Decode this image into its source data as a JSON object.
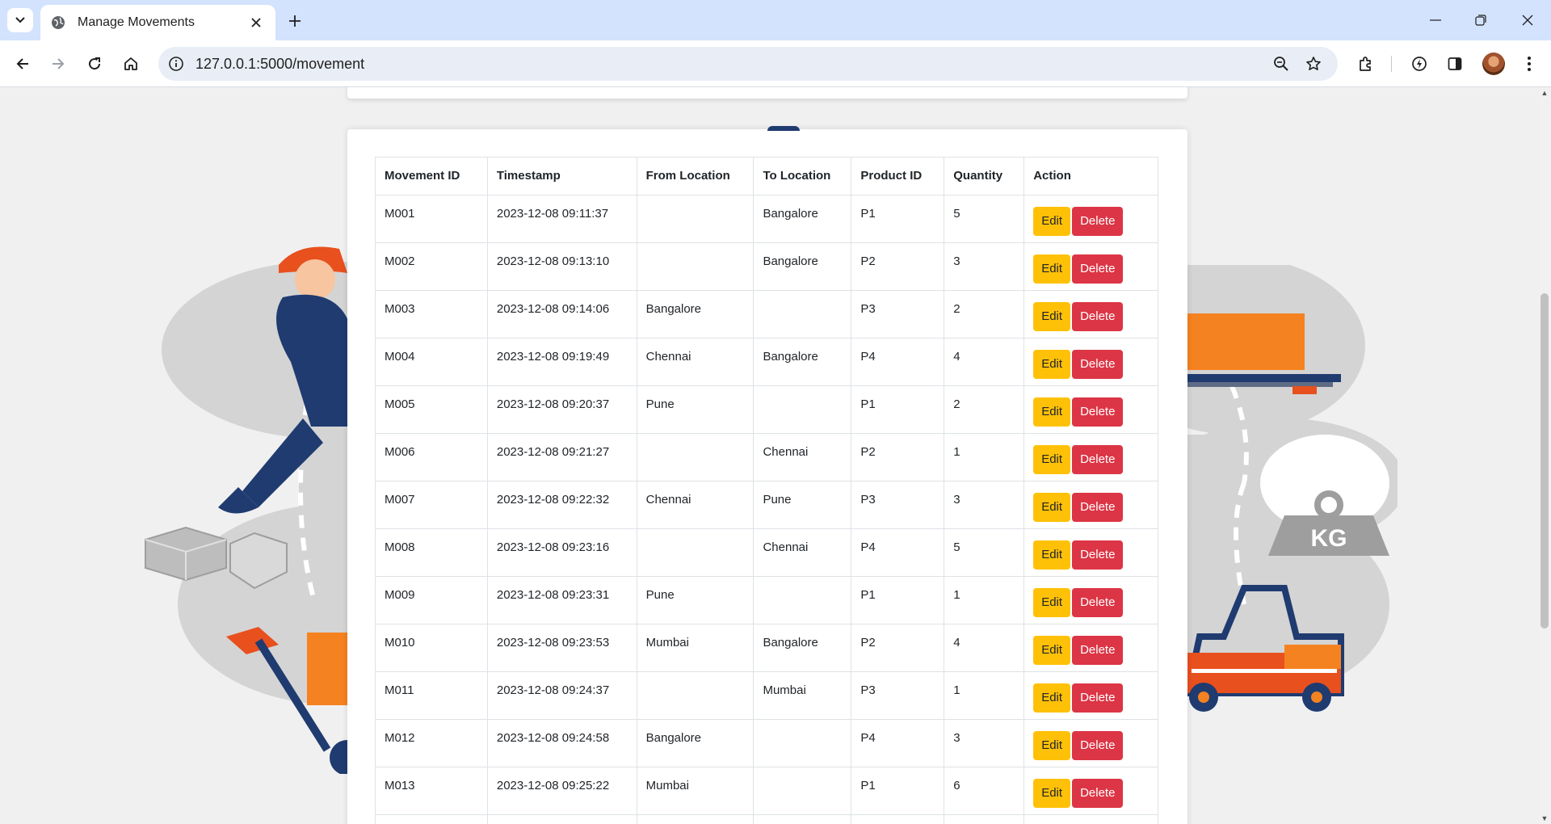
{
  "browser": {
    "tab_title": "Manage Movements",
    "url": "127.0.0.1:5000/movement"
  },
  "table": {
    "headers": [
      "Movement ID",
      "Timestamp",
      "From Location",
      "To Location",
      "Product ID",
      "Quantity",
      "Action"
    ],
    "rows": [
      {
        "id": "M001",
        "ts": "2023-12-08 09:11:37",
        "from": "",
        "to": "Bangalore",
        "product": "P1",
        "qty": "5"
      },
      {
        "id": "M002",
        "ts": "2023-12-08 09:13:10",
        "from": "",
        "to": "Bangalore",
        "product": "P2",
        "qty": "3"
      },
      {
        "id": "M003",
        "ts": "2023-12-08 09:14:06",
        "from": "Bangalore",
        "to": "",
        "product": "P3",
        "qty": "2"
      },
      {
        "id": "M004",
        "ts": "2023-12-08 09:19:49",
        "from": "Chennai",
        "to": "Bangalore",
        "product": "P4",
        "qty": "4"
      },
      {
        "id": "M005",
        "ts": "2023-12-08 09:20:37",
        "from": "Pune",
        "to": "",
        "product": "P1",
        "qty": "2"
      },
      {
        "id": "M006",
        "ts": "2023-12-08 09:21:27",
        "from": "",
        "to": "Chennai",
        "product": "P2",
        "qty": "1"
      },
      {
        "id": "M007",
        "ts": "2023-12-08 09:22:32",
        "from": "Chennai",
        "to": "Pune",
        "product": "P3",
        "qty": "3"
      },
      {
        "id": "M008",
        "ts": "2023-12-08 09:23:16",
        "from": "",
        "to": "Chennai",
        "product": "P4",
        "qty": "5"
      },
      {
        "id": "M009",
        "ts": "2023-12-08 09:23:31",
        "from": "Pune",
        "to": "",
        "product": "P1",
        "qty": "1"
      },
      {
        "id": "M010",
        "ts": "2023-12-08 09:23:53",
        "from": "Mumbai",
        "to": "Bangalore",
        "product": "P2",
        "qty": "4"
      },
      {
        "id": "M011",
        "ts": "2023-12-08 09:24:37",
        "from": "",
        "to": "Mumbai",
        "product": "P3",
        "qty": "1"
      },
      {
        "id": "M012",
        "ts": "2023-12-08 09:24:58",
        "from": "Bangalore",
        "to": "",
        "product": "P4",
        "qty": "3"
      },
      {
        "id": "M013",
        "ts": "2023-12-08 09:25:22",
        "from": "Mumbai",
        "to": "",
        "product": "P1",
        "qty": "6"
      },
      {
        "id": "",
        "ts": "",
        "from": "",
        "to": "",
        "product": "",
        "qty": ""
      }
    ],
    "edit_label": "Edit",
    "delete_label": "Delete"
  },
  "illustration": {
    "weight_label": "KG"
  },
  "colors": {
    "edit": "#ffc107",
    "delete": "#dc3545",
    "chrome": "#d3e3fd"
  },
  "icons": [
    "tab-list-icon",
    "globe-icon",
    "close-icon",
    "plus-icon",
    "minimize-icon",
    "restore-icon",
    "window-close-icon",
    "back-icon",
    "forward-icon",
    "reload-icon",
    "home-icon",
    "info-icon",
    "zoom-icon",
    "star-icon",
    "extensions-icon",
    "performance-icon",
    "side-panel-icon",
    "menu-icon"
  ]
}
